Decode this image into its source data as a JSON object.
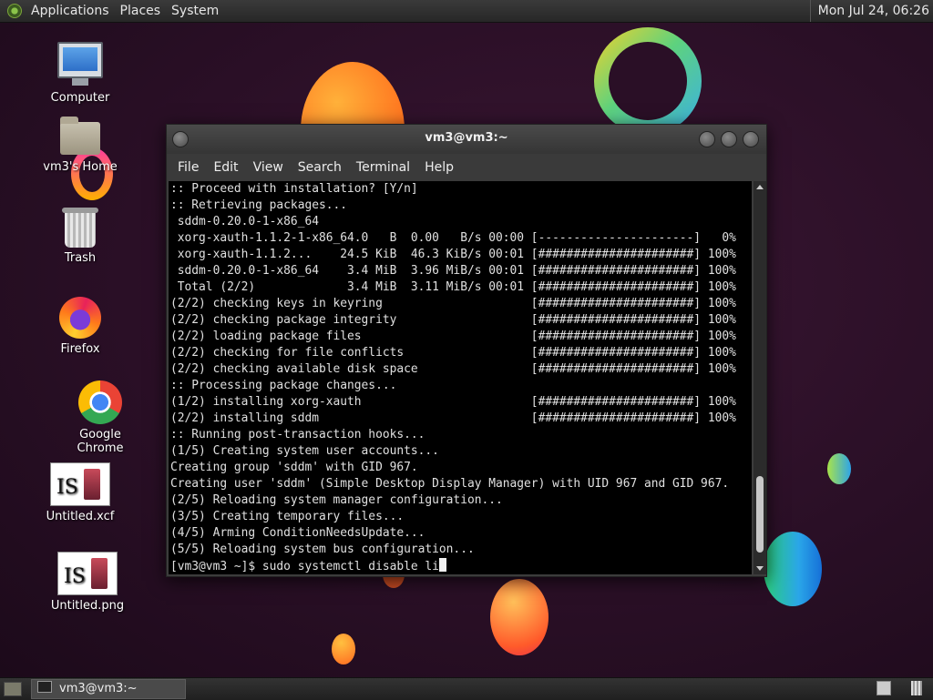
{
  "top_panel": {
    "menus": [
      "Applications",
      "Places",
      "System"
    ],
    "clock": "Mon Jul 24, 06:26",
    "logo_icon": "mate-logo-icon"
  },
  "desktop_icons": [
    {
      "label": "Computer",
      "icon": "computer-icon"
    },
    {
      "label": "vm3's Home",
      "icon": "home-folder-icon"
    },
    {
      "label": "Trash",
      "icon": "trash-icon"
    },
    {
      "label": "Firefox",
      "icon": "firefox-icon"
    },
    {
      "label": "Google Chrome",
      "icon": "chrome-icon"
    },
    {
      "label": "Untitled.xcf",
      "icon": "image-thumbnail-icon"
    },
    {
      "label": "Untitled.png",
      "icon": "image-thumbnail-icon"
    }
  ],
  "window": {
    "title": "vm3@vm3:~",
    "menu": [
      "File",
      "Edit",
      "View",
      "Search",
      "Terminal",
      "Help"
    ],
    "terminal_lines": [
      ":: Proceed with installation? [Y/n]",
      ":: Retrieving packages...",
      " sddm-0.20.0-1-x86_64",
      " xorg-xauth-1.1.2-1-x86_64.0   B  0.00   B/s 00:00 [----------------------]   0%",
      " xorg-xauth-1.1.2...    24.5 KiB  46.3 KiB/s 00:01 [######################] 100%",
      " sddm-0.20.0-1-x86_64    3.4 MiB  3.96 MiB/s 00:01 [######################] 100%",
      " Total (2/2)             3.4 MiB  3.11 MiB/s 00:01 [######################] 100%",
      "(2/2) checking keys in keyring                     [######################] 100%",
      "(2/2) checking package integrity                   [######################] 100%",
      "(2/2) loading package files                        [######################] 100%",
      "(2/2) checking for file conflicts                  [######################] 100%",
      "(2/2) checking available disk space                [######################] 100%",
      ":: Processing package changes...",
      "(1/2) installing xorg-xauth                        [######################] 100%",
      "(2/2) installing sddm                              [######################] 100%",
      ":: Running post-transaction hooks...",
      "(1/5) Creating system user accounts...",
      "Creating group 'sddm' with GID 967.",
      "Creating user 'sddm' (Simple Desktop Display Manager) with UID 967 and GID 967.",
      "(2/5) Reloading system manager configuration...",
      "(3/5) Creating temporary files...",
      "(4/5) Arming ConditionNeedsUpdate...",
      "(5/5) Reloading system bus configuration..."
    ],
    "prompt": "[vm3@vm3 ~]$ sudo systemctl disable li"
  },
  "bottom_panel": {
    "task_label": "vm3@vm3:~"
  }
}
